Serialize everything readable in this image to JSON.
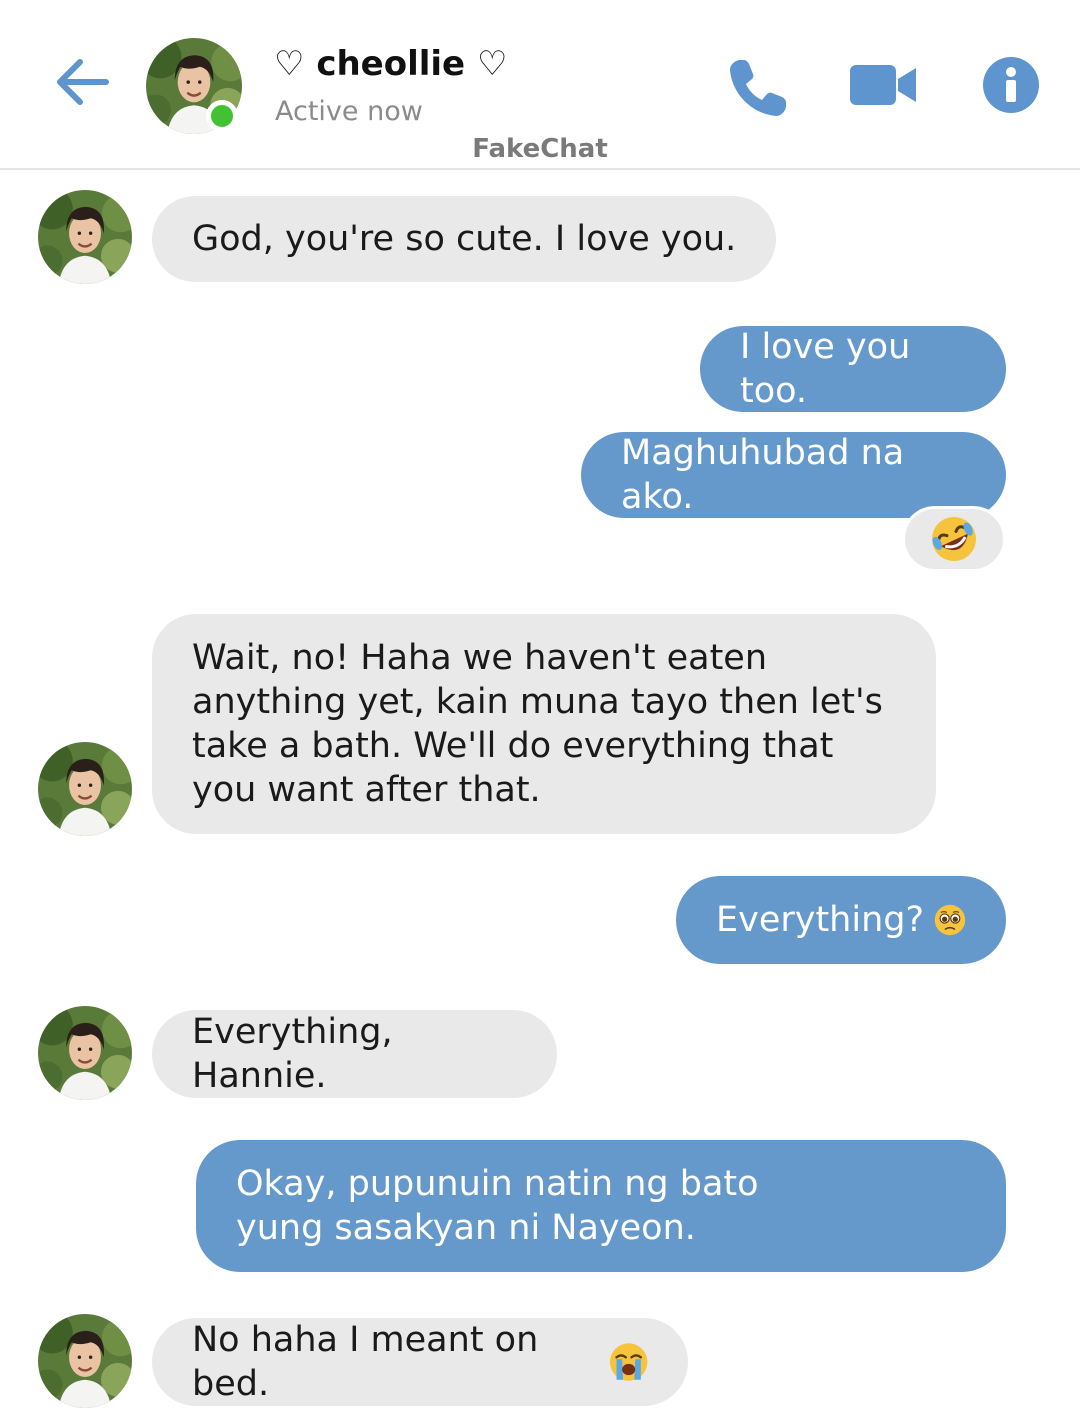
{
  "header": {
    "contact_name": "♡ cheollie ♡",
    "status": "Active now",
    "app_label": "FakeChat",
    "icons": {
      "back": "back-arrow-icon",
      "call": "phone-icon",
      "video": "video-camera-icon",
      "info": "info-icon"
    }
  },
  "colors": {
    "accent": "#5f95cf",
    "outgoing_bubble": "#6599cb",
    "incoming_bubble": "#e9e9e9",
    "online": "#42c233"
  },
  "messages": [
    {
      "from": "them",
      "text": "God, you're so cute. I love you."
    },
    {
      "from": "me",
      "text": "I love you too."
    },
    {
      "from": "me",
      "text": "Maghuhubad na ako.",
      "reaction": "rolling-on-floor-laughing-emoji"
    },
    {
      "from": "them",
      "text": "Wait, no! Haha we haven't eaten anything yet, kain muna tayo then let's take a bath. We'll do everything that you want after that."
    },
    {
      "from": "me",
      "text": "Everything?",
      "emoji": "pleading-face-emoji"
    },
    {
      "from": "them",
      "text": "Everything, Hannie."
    },
    {
      "from": "me",
      "text": "Okay, pupunuin natin ng bato yung sasakyan ni Nayeon."
    },
    {
      "from": "them",
      "text": "No haha I meant on bed.",
      "emoji": "loudly-crying-face-emoji"
    }
  ]
}
